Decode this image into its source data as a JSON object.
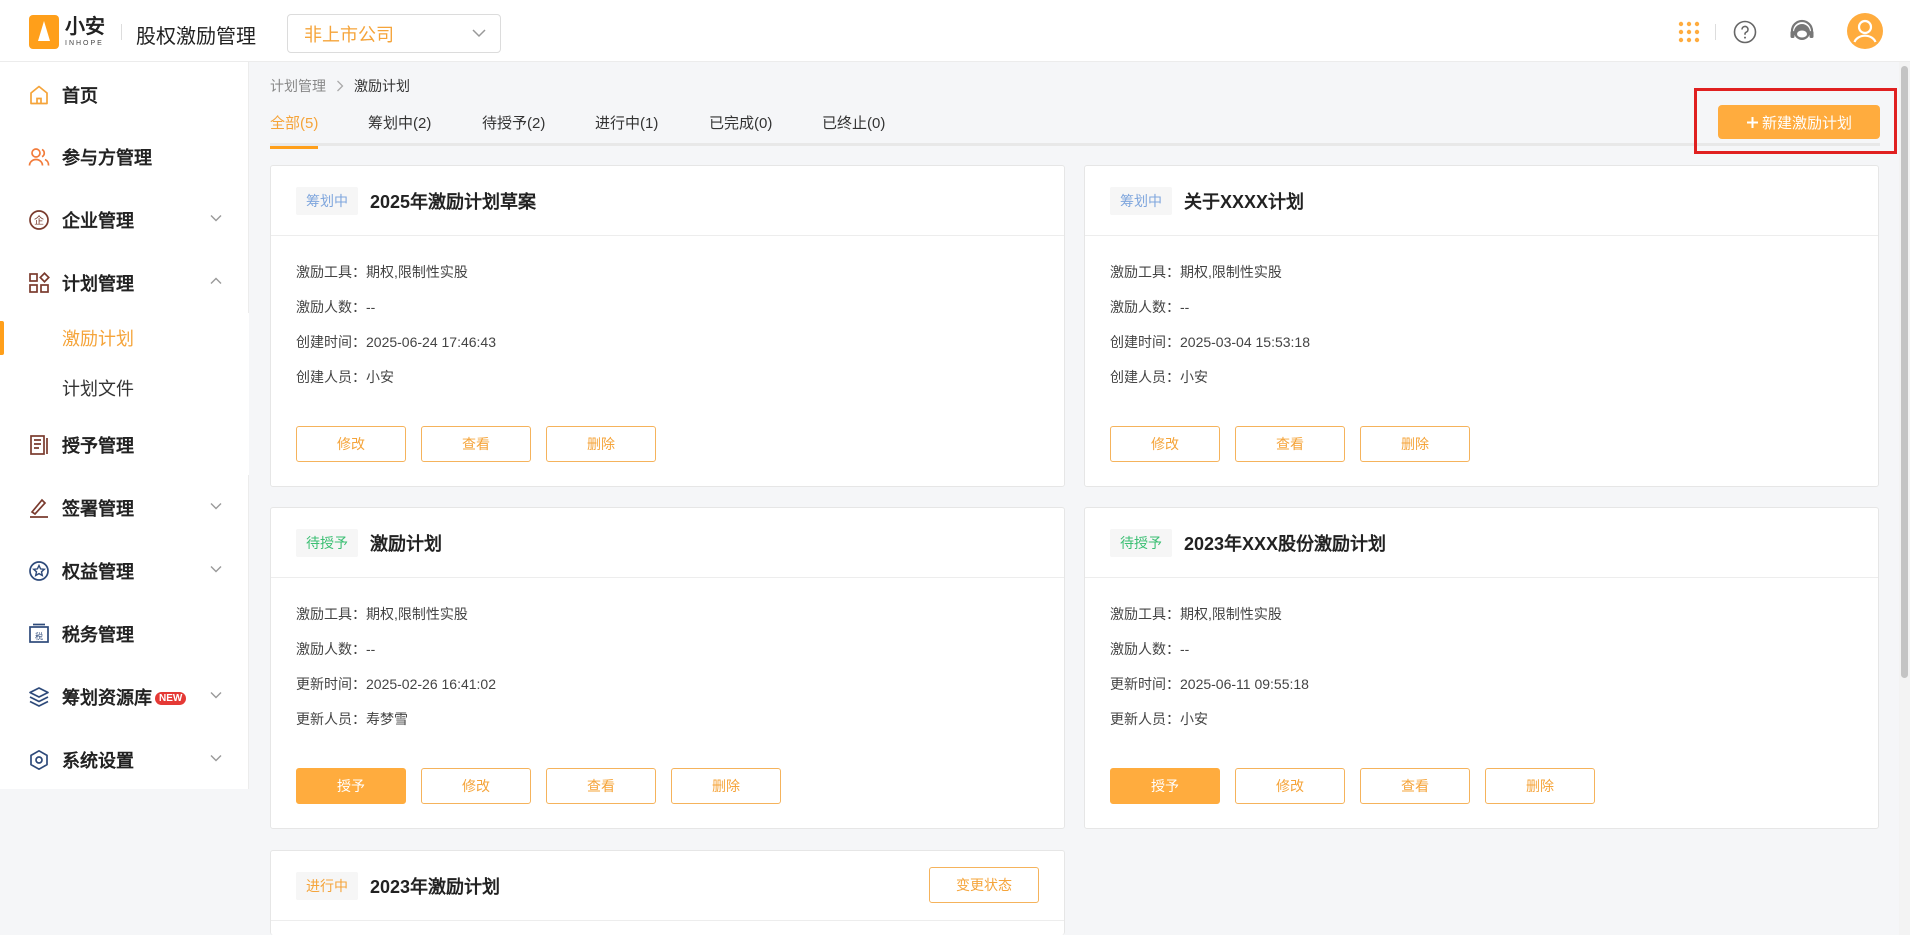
{
  "header": {
    "logo_name": "小安",
    "logo_sub": "INHOPE",
    "app_title": "股权激励管理",
    "company_select": "非上市公司"
  },
  "sidebar": {
    "items": [
      {
        "label": "首页",
        "icon": "home-icon"
      },
      {
        "label": "参与方管理",
        "icon": "users-icon"
      },
      {
        "label": "企业管理",
        "icon": "enterprise-icon"
      },
      {
        "label": "计划管理",
        "icon": "grid-icon"
      },
      {
        "label": "授予管理",
        "icon": "book-icon"
      },
      {
        "label": "签署管理",
        "icon": "sign-icon"
      },
      {
        "label": "权益管理",
        "icon": "rights-icon"
      },
      {
        "label": "税务管理",
        "icon": "tax-icon"
      },
      {
        "label": "筹划资源库",
        "icon": "layers-icon",
        "badge": "NEW"
      },
      {
        "label": "系统设置",
        "icon": "settings-icon"
      }
    ],
    "sub_items": [
      {
        "label": "激励计划"
      },
      {
        "label": "计划文件"
      }
    ]
  },
  "breadcrumb": {
    "parent": "计划管理",
    "current": "激励计划"
  },
  "tabs": [
    {
      "label": "全部(5)"
    },
    {
      "label": "筹划中(2)"
    },
    {
      "label": "待授予(2)"
    },
    {
      "label": "进行中(1)"
    },
    {
      "label": "已完成(0)"
    },
    {
      "label": "已终止(0)"
    }
  ],
  "new_button": "新建激励计划",
  "cards": [
    {
      "status": "筹划中",
      "title": "2025年激励计划草案",
      "rows": [
        "激励工具：期权,限制性实股",
        "激励人数：--",
        "创建时间：2025-06-24 17:46:43",
        "创建人员：小安"
      ],
      "buttons": [
        "修改",
        "查看",
        "删除"
      ]
    },
    {
      "status": "筹划中",
      "title": "关于XXXX计划",
      "rows": [
        "激励工具：期权,限制性实股",
        "激励人数：--",
        "创建时间：2025-03-04 15:53:18",
        "创建人员：小安"
      ],
      "buttons": [
        "修改",
        "查看",
        "删除"
      ]
    },
    {
      "status": "待授予",
      "title": "激励计划",
      "rows": [
        "激励工具：期权,限制性实股",
        "激励人数：--",
        "更新时间：2025-02-26 16:41:02",
        "更新人员：寿梦雪"
      ],
      "buttons": [
        "授予",
        "修改",
        "查看",
        "删除"
      ]
    },
    {
      "status": "待授予",
      "title": "2023年XXX股份激励计划",
      "rows": [
        "激励工具：期权,限制性实股",
        "激励人数：--",
        "更新时间：2025-06-11 09:55:18",
        "更新人员：小安"
      ],
      "buttons": [
        "授予",
        "修改",
        "查看",
        "删除"
      ]
    },
    {
      "status": "进行中",
      "title": "2023年激励计划",
      "change_button": "变更状态"
    }
  ],
  "colors": {
    "accent": "#ffac3e",
    "accent_text": "#f5a43a",
    "highlight": "#e02020"
  }
}
